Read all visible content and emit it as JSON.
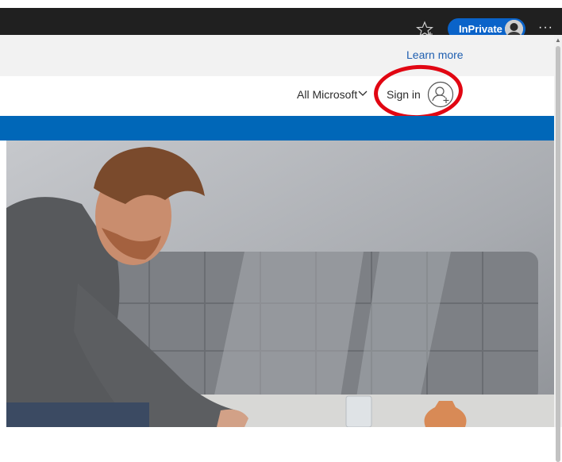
{
  "browser": {
    "inprivate_label": "InPrivate",
    "more_label": "···",
    "icons": [
      "star-icon",
      "profile-avatar",
      "more-icon"
    ]
  },
  "banner": {
    "learn_more": "Learn more"
  },
  "header": {
    "all_microsoft": "All Microsoft",
    "sign_in": "Sign in",
    "icons": [
      "chevron-down-icon",
      "user-plus-icon"
    ]
  },
  "colors": {
    "brand_blue": "#0067b8",
    "inprivate_blue": "#0a63c9",
    "highlight_red": "#e10612",
    "browser_bar": "#202020"
  }
}
